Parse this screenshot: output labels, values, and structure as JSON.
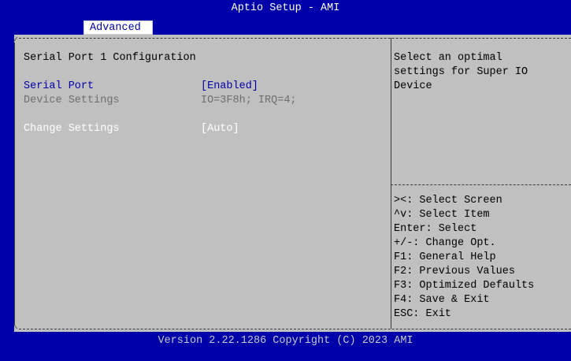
{
  "window": {
    "title": "Aptio Setup - AMI"
  },
  "tabs": [
    {
      "label": "Advanced",
      "active": true
    }
  ],
  "page": {
    "heading": "Serial Port 1 Configuration",
    "settings": [
      {
        "label": "Serial Port",
        "value": "[Enabled]"
      },
      {
        "label": "Device Settings",
        "value": "IO=3F8h; IRQ=4;"
      },
      {
        "label": "Change Settings",
        "value": "[Auto]"
      }
    ]
  },
  "help": {
    "lines": [
      "Select an optimal",
      "settings for Super IO",
      "Device"
    ]
  },
  "keys": [
    "><: Select Screen",
    "^v: Select Item",
    "Enter: Select",
    "+/-: Change Opt.",
    "F1: General Help",
    "F2: Previous Values",
    "F3: Optimized Defaults",
    "F4: Save & Exit",
    "ESC: Exit"
  ],
  "footer": {
    "text": "Version 2.22.1286 Copyright (C) 2023 AMI"
  },
  "colors": {
    "background": "#0000aa",
    "panel": "#c0c0c0",
    "highlight": "#ffffff",
    "disabled_text": "#6e6e6e",
    "label_text": "#0000aa"
  }
}
